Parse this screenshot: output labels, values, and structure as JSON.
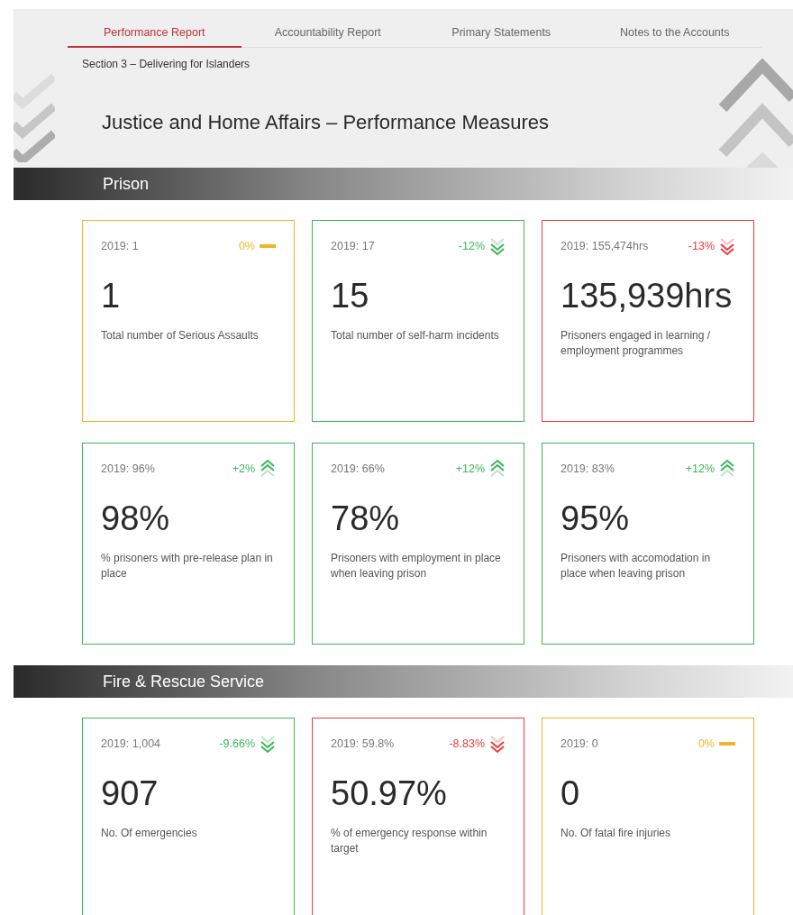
{
  "tabs": [
    {
      "label": "Performance Report",
      "selected": true
    },
    {
      "label": "Accountability Report",
      "selected": false
    },
    {
      "label": "Primary Statements",
      "selected": false
    },
    {
      "label": "Notes to the Accounts",
      "selected": false
    }
  ],
  "breadcrumb": "Section 3 – Delivering for Islanders",
  "title": "Justice and Home Affairs – Performance Measures",
  "sections": [
    {
      "heading": "Prison",
      "cards": [
        {
          "previous": "2019: 1",
          "change": "0%",
          "kind": "flat",
          "color": "#f0b429",
          "value": "1",
          "label": "Total number of Serious Assaults"
        },
        {
          "previous": "2019: 17",
          "change": "-12%",
          "kind": "down",
          "color": "#3cb55a",
          "value": "15",
          "label": "Total number of self-harm incidents"
        },
        {
          "previous": "2019: 155,474hrs",
          "change": "-13%",
          "kind": "down",
          "color": "#ee3b3b",
          "value": "135,939hrs",
          "label": "Prisoners engaged in learning / employment programmes"
        },
        {
          "previous": "2019: 96%",
          "change": "+2%",
          "kind": "up",
          "color": "#3cb55a",
          "value": "98%",
          "label": "% prisoners with pre-release plan in place"
        },
        {
          "previous": "2019: 66%",
          "change": "+12%",
          "kind": "up",
          "color": "#3cb55a",
          "value": "78%",
          "label": "Prisoners with employment in place when leaving prison"
        },
        {
          "previous": "2019: 83%",
          "change": "+12%",
          "kind": "up",
          "color": "#3cb55a",
          "value": "95%",
          "label": "Prisoners with accomodation in place when leaving prison"
        }
      ]
    },
    {
      "heading": "Fire & Rescue Service",
      "cards": [
        {
          "previous": "2019: 1,004",
          "change": "-9.66%",
          "kind": "down",
          "color": "#3cb55a",
          "value": "907",
          "label": "No. Of emergencies"
        },
        {
          "previous": "2019: 59.8%",
          "change": "-8.83%",
          "kind": "down",
          "color": "#ee3b3b",
          "value": "50.97%",
          "label": "% of emergency response within target"
        },
        {
          "previous": "2019: 0",
          "change": "0%",
          "kind": "flat",
          "color": "#f0b429",
          "value": "0",
          "label": "No. Of fatal fire injuries"
        }
      ]
    }
  ]
}
